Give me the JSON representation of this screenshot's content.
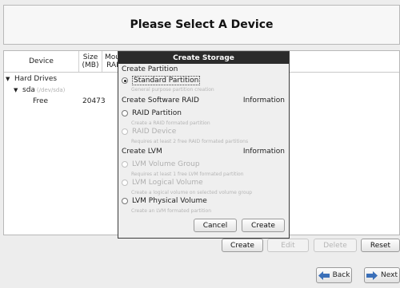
{
  "header": {
    "title": "Please Select A Device"
  },
  "table": {
    "columns": {
      "device": "Device",
      "size": "Size\n(MB)",
      "mount": "Mou\nRAI"
    },
    "rows": {
      "hard_drives": "Hard Drives",
      "sda": "sda",
      "sda_path": "(/dev/sda)",
      "free": "Free",
      "free_size": "20473"
    }
  },
  "actions": {
    "create": "Create",
    "edit": "Edit",
    "delete": "Delete",
    "reset": "Reset"
  },
  "nav": {
    "back": "Back",
    "next": "Next"
  },
  "dialog": {
    "title": "Create Storage",
    "sections": {
      "partition": "Create Partition",
      "raid": "Create Software RAID",
      "raid_info": "Information",
      "lvm": "Create LVM",
      "lvm_info": "Information"
    },
    "options": {
      "standard": "Standard Partition",
      "standard_desc": "General purpose partition creation",
      "raid_partition": "RAID Partition",
      "raid_partition_desc": "Create a RAID formated partition",
      "raid_device": "RAID Device",
      "raid_device_desc": "Requires at least 2 free RAID formated partitions",
      "lvm_vg": "LVM Volume Group",
      "lvm_vg_desc": "Requires at least 1 free LVM formated partition",
      "lvm_lv": "LVM Logical Volume",
      "lvm_lv_desc": "Create a logical volume on selected volume group",
      "lvm_pv": "LVM Physical Volume",
      "lvm_pv_desc": "Create an LVM formated partition"
    },
    "buttons": {
      "cancel": "Cancel",
      "create": "Create"
    }
  },
  "colors": {
    "dialog_title_bg": "#2b2b2b",
    "nav_arrow": "#3a6fb8"
  }
}
